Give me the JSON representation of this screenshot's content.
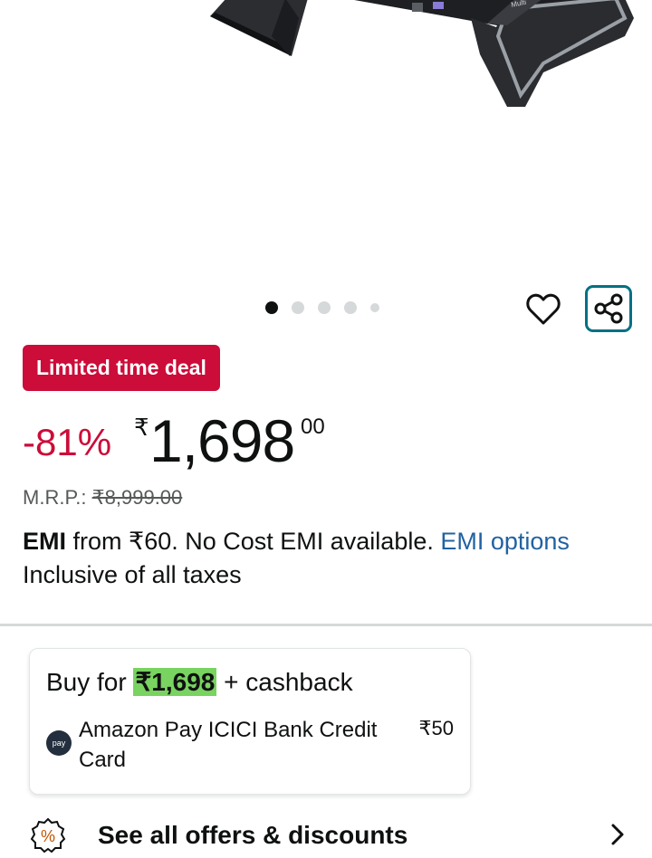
{
  "gallery": {
    "dots_total": 5,
    "active_dot": 1
  },
  "deal": {
    "badge": "Limited time deal"
  },
  "price": {
    "discount": "-81%",
    "currency_symbol": "₹",
    "whole": "1,698",
    "fraction": "00"
  },
  "mrp": {
    "label": "M.R.P.:",
    "value": "₹8,999.00"
  },
  "emi": {
    "bold": "EMI",
    "text": " from ₹60. No Cost EMI available. ",
    "link": "EMI options"
  },
  "taxes": "Inclusive of all taxes",
  "offer": {
    "prefix": "Buy for ",
    "price": "₹1,698",
    "suffix": " + cashback",
    "logo_text": "pay",
    "bank": "Amazon Pay ICICI Bank Credit Card",
    "amount": "₹50"
  },
  "offers_link": {
    "label": "See all offers & discounts",
    "icon_symbol": "%"
  },
  "colors": {
    "deal_red": "#cc0c39",
    "link_blue": "#2162a1",
    "share_teal": "#007185",
    "highlight_green": "#79d360"
  }
}
